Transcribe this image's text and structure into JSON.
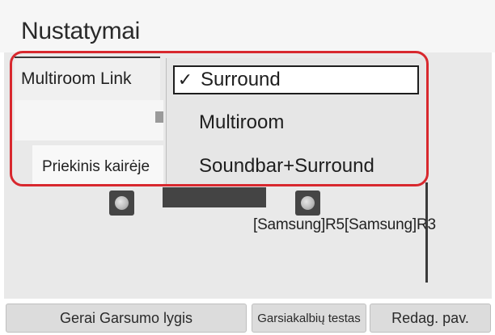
{
  "header": {
    "title": "Nustatymai"
  },
  "setting": {
    "label": "Multiroom Link"
  },
  "dropdown": {
    "options": [
      {
        "label": "Surround",
        "selected": true,
        "check": "✓"
      },
      {
        "label": "Multiroom",
        "selected": false
      },
      {
        "label": "Soundbar+Surround",
        "selected": false
      }
    ]
  },
  "speakers": {
    "front_left_label": "Priekinis kairėje",
    "devices_label": "[Samsung]R5[Samsung]R3",
    "icon": "speaker-icon"
  },
  "buttons": {
    "ok_volume": "Gerai Garsumo lygis",
    "speaker_test": "Garsiakalbių testas",
    "edit_name": "Redag. pav."
  },
  "colors": {
    "highlight": "#d8282e",
    "background": "#e9e9e9"
  }
}
